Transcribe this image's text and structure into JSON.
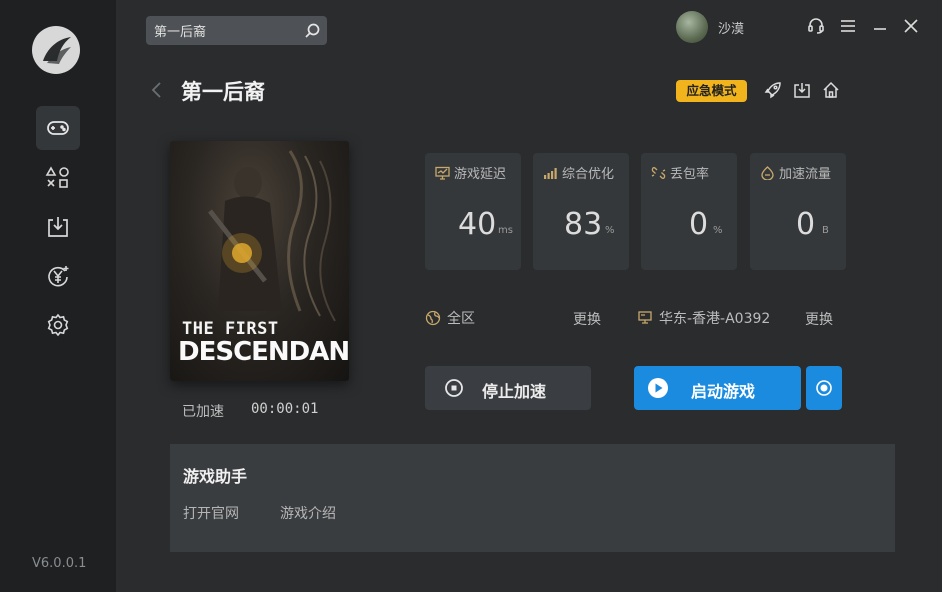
{
  "sidebar": {
    "items": [
      {
        "icon": "gamepad-icon",
        "active": true
      },
      {
        "icon": "apps-icon"
      },
      {
        "icon": "download-icon"
      },
      {
        "icon": "yen-coin-icon"
      },
      {
        "icon": "gear-icon"
      }
    ],
    "version": "V6.0.0.1"
  },
  "topbar": {
    "search_value": "第一后裔",
    "username": "沙漠"
  },
  "header": {
    "title": "第一后裔",
    "emergency_label": "应急模式"
  },
  "game": {
    "cover_line1": "THE FIRST",
    "cover_line2": "DESCENDANT",
    "accel_label": "已加速",
    "accel_time": "00:00:01"
  },
  "stats": [
    {
      "label": "游戏延迟",
      "value": "40",
      "unit": "ms",
      "icon": "monitor-icon"
    },
    {
      "label": "综合优化",
      "value": "83",
      "unit": "%",
      "icon": "signal-bars-icon"
    },
    {
      "label": "丢包率",
      "value": "0",
      "unit": "%",
      "icon": "broken-link-icon"
    },
    {
      "label": "加速流量",
      "value": "0",
      "unit": "B",
      "icon": "flow-icon"
    }
  ],
  "region": {
    "zone": "全区",
    "zone_change": "更换",
    "node": "华东-香港-A0392",
    "node_change": "更换"
  },
  "actions": {
    "stop": "停止加速",
    "launch": "启动游戏"
  },
  "assistant": {
    "title": "游戏助手",
    "link1": "打开官网",
    "link2": "游戏介绍"
  },
  "colors": {
    "accent": "#1b8be0",
    "emergency": "#f2b41c",
    "background": "#2a2c2e",
    "sidebar": "#1e2022"
  }
}
